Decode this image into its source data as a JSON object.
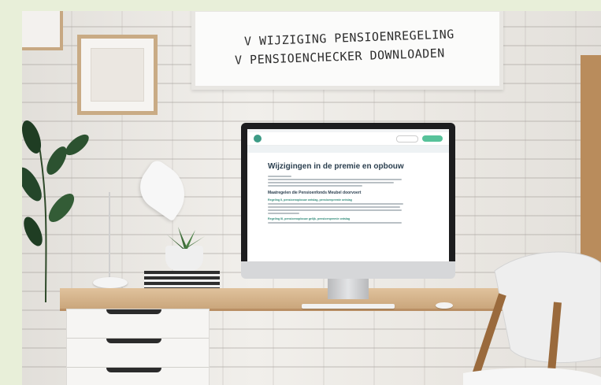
{
  "board": {
    "line1": "V WIJZIGING PENSIOENREGELING",
    "line2": "V PENSIOENCHECKER DOWNLOADEN"
  },
  "screen": {
    "title": "Wijzigingen in de premie en opbouw",
    "subtitle": "Maatregelen die Pensioenfonds Meubel doorvoert",
    "section1": "Regeling II, pensioenopbouw ontslag, pensioenpremie ontslag",
    "section2": "Regeling III, pensioenopbouw gelijk, pensioenpremie ontslag"
  },
  "colors": {
    "background": "#e8efd9",
    "accent": "#57c29a",
    "heading": "#2b3f4f"
  }
}
